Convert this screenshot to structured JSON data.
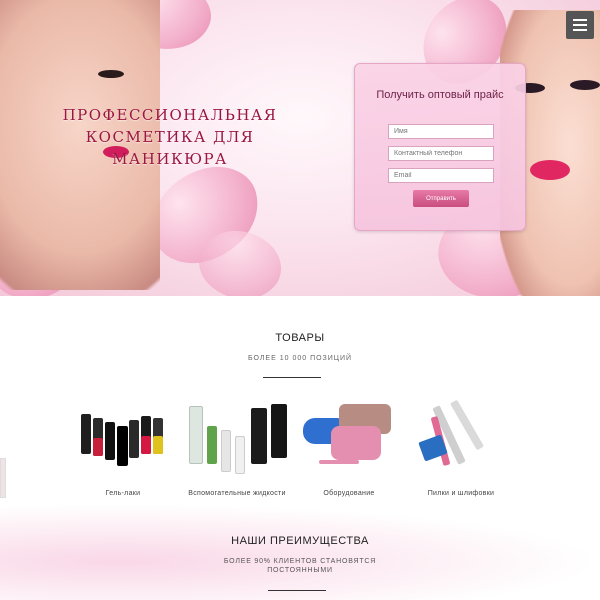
{
  "hero": {
    "title": "ПРОФЕССИОНАЛЬНАЯ КОСМЕТИКА ДЛЯ МАНИКЮРА",
    "menu_icon": "hamburger-menu-icon"
  },
  "form": {
    "title": "Получить оптовый прайс",
    "name_placeholder": "Имя",
    "phone_placeholder": "Контактный телефон",
    "email_placeholder": "Email",
    "submit_label": "Отправить"
  },
  "goods": {
    "title": "ТОВАРЫ",
    "subtitle": "БОЛЕЕ 10 000 ПОЗИЦИЙ",
    "items": [
      {
        "label": "Гель-лаки"
      },
      {
        "label": "Вспомогательные жидкости"
      },
      {
        "label": "Оборудование"
      },
      {
        "label": "Пилки и шлифовки"
      }
    ]
  },
  "advantages": {
    "title": "НАШИ ПРЕИМУЩЕСТВА",
    "subtitle": "БОЛЕЕ 90% КЛИЕНТОВ СТАНОВЯТСЯ ПОСТОЯННЫМИ"
  },
  "colors": {
    "accent": "#9b1640",
    "button": "#d45d8f",
    "hero_bg": "#fbe4ee"
  }
}
